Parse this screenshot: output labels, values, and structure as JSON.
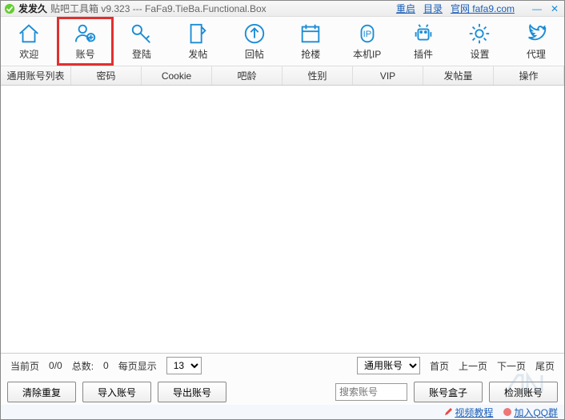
{
  "title": {
    "app": "发发久",
    "sub": "贴吧工具箱 v9.323 --- FaFa9.TieBa.Functional.Box"
  },
  "titlelinks": {
    "restart": "重启",
    "catalog": "目录",
    "site": "官网 fafa9.com"
  },
  "tools": [
    {
      "id": "welcome",
      "label": "欢迎"
    },
    {
      "id": "account",
      "label": "账号"
    },
    {
      "id": "login",
      "label": "登陆"
    },
    {
      "id": "post",
      "label": "发帖"
    },
    {
      "id": "reply",
      "label": "回帖"
    },
    {
      "id": "grab",
      "label": "抢楼"
    },
    {
      "id": "ip",
      "label": "本机IP"
    },
    {
      "id": "plugin",
      "label": "插件"
    },
    {
      "id": "settings",
      "label": "设置"
    },
    {
      "id": "proxy",
      "label": "代理"
    }
  ],
  "cols": [
    "通用账号列表",
    "密码",
    "Cookie",
    "吧龄",
    "性别",
    "VIP",
    "发帖量",
    "操作"
  ],
  "pager": {
    "curpage_lbl": "当前页",
    "curpage_val": "0/0",
    "total_lbl": "总数:",
    "total_val": "0",
    "perpage_lbl": "每页显示",
    "perpage_val": "13",
    "scope": "通用账号",
    "first": "首页",
    "prev": "上一页",
    "next": "下一页",
    "last": "尾页"
  },
  "btns": {
    "dedup": "清除重复",
    "import": "导入账号",
    "export": "导出账号",
    "search_ph": "搜索账号",
    "box": "账号盒子",
    "check": "检测账号"
  },
  "footer": {
    "video": "视频教程",
    "qq": "加入QQ群"
  }
}
